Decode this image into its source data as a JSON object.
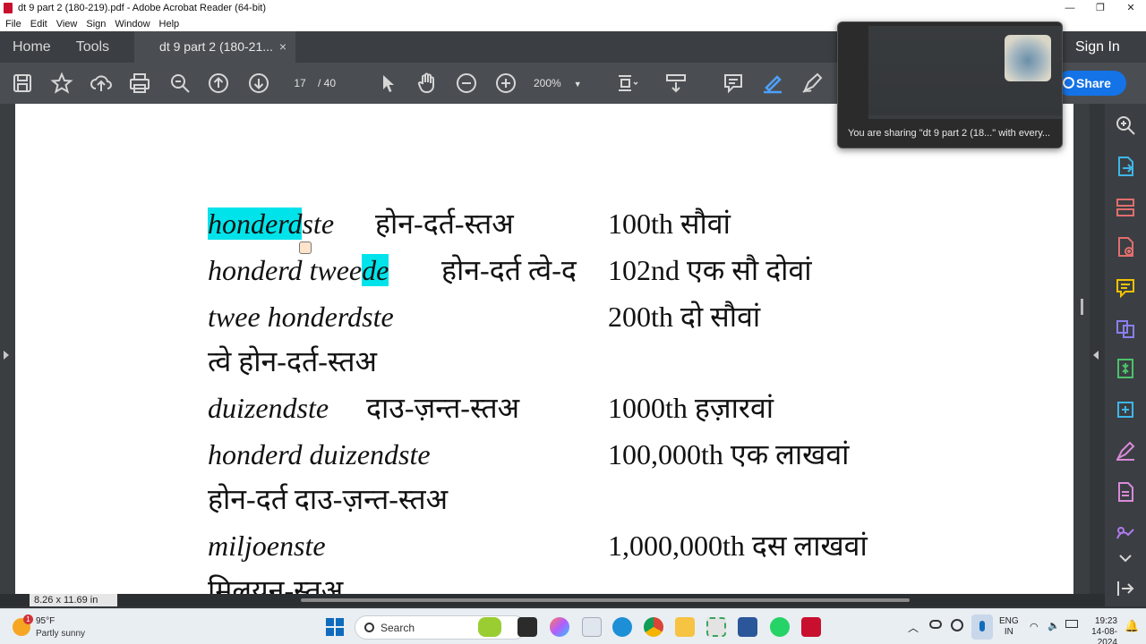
{
  "window": {
    "title": "dt 9 part 2 (180-219).pdf - Adobe Acrobat Reader (64-bit)",
    "controls": [
      "—",
      "❐",
      "✕"
    ]
  },
  "menu": [
    "File",
    "Edit",
    "View",
    "Sign",
    "Window",
    "Help"
  ],
  "tabs": {
    "home": "Home",
    "tools": "Tools",
    "document": "dt 9 part 2 (180-21...",
    "close": "×",
    "sign_in": "Sign In"
  },
  "toolbar": {
    "page_current": "17",
    "page_total": "/ 40",
    "zoom": "200%",
    "share": "Share",
    "icons": [
      "save-icon",
      "star-icon",
      "upload-icon",
      "print-icon",
      "zoom-search-icon",
      "page-up-icon",
      "page-down-icon",
      "select-cursor-icon",
      "hand-icon",
      "zoom-out-icon",
      "zoom-in-icon",
      "page-fit-icon",
      "scroll-mode-icon",
      "comment-icon",
      "highlight-icon",
      "sign-icon"
    ]
  },
  "sharing": {
    "message": "You are sharing \"dt 9 part 2 (18...\" with every..."
  },
  "document": {
    "lines": [
      {
        "a_hl": "honderd",
        "a_rest": "ste",
        "b": "होन-दर्त-स्तअ",
        "c": "100th सौवां"
      },
      {
        "a_pre": "honderd twee",
        "a_hl": "de",
        "b": "होन-दर्त त्वे-द",
        "c": "102nd एक सौ दोवां"
      },
      {
        "a": "twee honderdste",
        "c": "200th दो सौवां"
      },
      {
        "b": "त्वे होन-दर्त-स्तअ"
      },
      {
        "a": "duizendste",
        "b": "दाउ-ज़न्त-स्तअ",
        "c": "1000th हज़ारवां"
      },
      {
        "a": "honderd duizendste",
        "c": "100,000th एक लाखवां"
      },
      {
        "b": "होन-दर्त दाउ-ज़न्त-स्तअ"
      },
      {
        "a": "miljoenste",
        "c": "1,000,000th दस लाखवां"
      },
      {
        "b": "मिलयन-स्तअ"
      }
    ]
  },
  "status": {
    "page_size": "8.26 x 11.69 in"
  },
  "right_panel_icons": [
    "search-zoom-icon",
    "export-pdf-icon",
    "organize-pages-icon",
    "create-pdf-icon",
    "comment-tool-icon",
    "combine-files-icon",
    "compress-icon",
    "edit-pdf-icon",
    "fill-sign-icon",
    "scan-ocr-icon",
    "protect-icon",
    "chevron-down-icon",
    "collapse-panel-icon"
  ],
  "taskbar": {
    "weather_temp": "95°F",
    "weather_cond": "Partly sunny",
    "weather_badge": "1",
    "search": "Search",
    "lang_line1": "ENG",
    "lang_line2": "IN",
    "time": "19:23",
    "date": "14-08-2024"
  }
}
